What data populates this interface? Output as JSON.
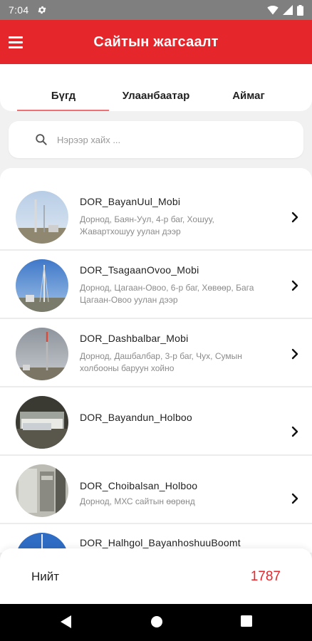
{
  "status_bar": {
    "time": "7:04",
    "icons": [
      "gear-icon",
      "wifi-icon",
      "signal-icon",
      "battery-icon"
    ]
  },
  "app_bar": {
    "title": "Сайтын жагсаалт",
    "menu_icon": "menu-icon"
  },
  "tabs": [
    {
      "label": "Бүгд",
      "selected": true
    },
    {
      "label": "Улаанбаатар",
      "selected": false
    },
    {
      "label": "Аймаг",
      "selected": false
    }
  ],
  "search": {
    "placeholder": "Нэрээр хайх ...",
    "value": ""
  },
  "sites": [
    {
      "name": "DOR_BayanUul_Mobi",
      "address": "Дорнод, Баян-Уул, 4-р баг, Хошуу, Жавартхошуу уулан дээр"
    },
    {
      "name": "DOR_TsagaanOvoo_Mobi",
      "address": "Дорнод, Цагаан-Овоо, 6-р баг, Хөвөөр, Бага Цагаан-Овоо уулан дээр"
    },
    {
      "name": "DOR_Dashbalbar_Mobi",
      "address": "Дорнод, Дашбалбар, 3-р баг, Чух, Сумын холбооны баруун хойно"
    },
    {
      "name": "DOR_Bayandun_Holboo",
      "address": ""
    },
    {
      "name": "DOR_Choibalsan_Holboo",
      "address": "Дорнод, МХС сайтын өөрөнд"
    },
    {
      "name": "DOR_Halhgol_BayanhoshuuBoomt",
      "address": ""
    }
  ],
  "footer": {
    "total_label": "Нийт",
    "total_value": "1787"
  },
  "colors": {
    "primary": "#e5262b",
    "background": "#f1f1f1",
    "status_bar": "#7f7f7f"
  },
  "nav": {
    "back_icon": "back-icon",
    "home_icon": "home-icon",
    "recents_icon": "recents-icon"
  }
}
